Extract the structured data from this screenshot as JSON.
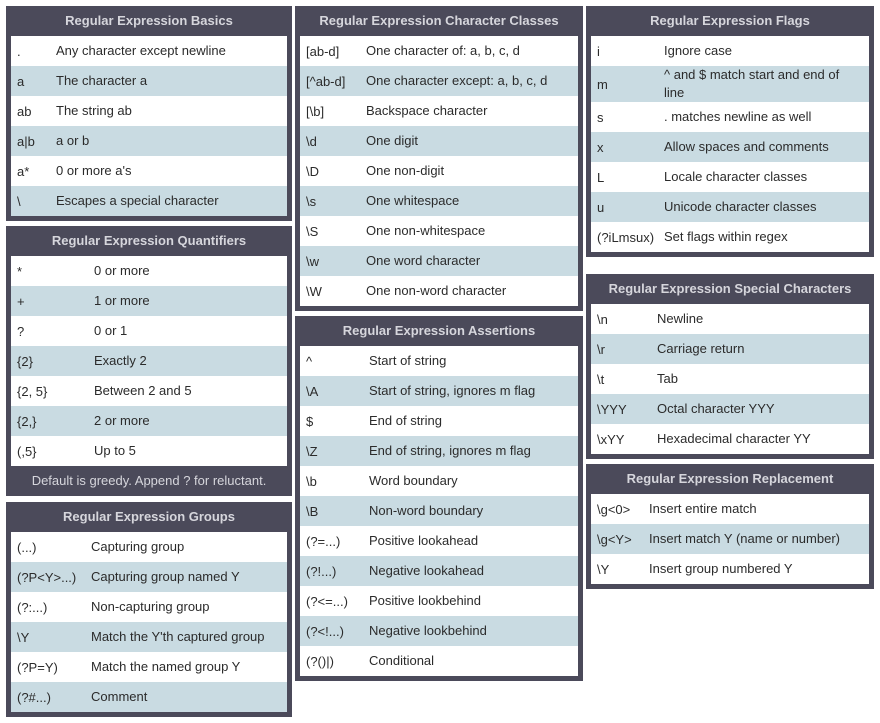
{
  "basics": {
    "title": "Regular Expression Basics",
    "rows": [
      {
        "k": ".",
        "v": "Any character except newline"
      },
      {
        "k": "a",
        "v": "The character a"
      },
      {
        "k": "ab",
        "v": "The string ab"
      },
      {
        "k": "a|b",
        "v": "a or b"
      },
      {
        "k": "a*",
        "v": "0 or more a's"
      },
      {
        "k": "\\",
        "v": "Escapes a special character"
      }
    ]
  },
  "quantifiers": {
    "title": "Regular Expression Quantifiers",
    "rows": [
      {
        "k": "*",
        "v": "0 or more"
      },
      {
        "k": "+",
        "v": "1 or more"
      },
      {
        "k": "?",
        "v": "0 or 1"
      },
      {
        "k": "{2}",
        "v": "Exactly 2"
      },
      {
        "k": "{2, 5}",
        "v": "Between 2 and 5"
      },
      {
        "k": "{2,}",
        "v": "2 or more"
      },
      {
        "k": "(,5}",
        "v": "Up to 5"
      }
    ],
    "footer": "Default is greedy. Append ? for reluctant."
  },
  "groups": {
    "title": "Regular Expression Groups",
    "rows": [
      {
        "k": "(...)",
        "v": "Capturing group"
      },
      {
        "k": "(?P<Y>...)",
        "v": "Capturing group named Y"
      },
      {
        "k": "(?:...)",
        "v": "Non-capturing group"
      },
      {
        "k": "\\Y",
        "v": "Match the Y'th captured group"
      },
      {
        "k": "(?P=Y)",
        "v": "Match the named group Y"
      },
      {
        "k": "(?#...)",
        "v": "Comment"
      }
    ]
  },
  "character_classes": {
    "title": "Regular Expression Character Classes",
    "rows": [
      {
        "k": "[ab-d]",
        "v": "One character of: a, b, c, d"
      },
      {
        "k": "[^ab-d]",
        "v": "One character except: a, b, c, d"
      },
      {
        "k": "[\\b]",
        "v": "Backspace character"
      },
      {
        "k": "\\d",
        "v": "One digit"
      },
      {
        "k": "\\D",
        "v": "One non-digit"
      },
      {
        "k": "\\s",
        "v": "One whitespace"
      },
      {
        "k": "\\S",
        "v": "One non-whitespace"
      },
      {
        "k": "\\w",
        "v": "One word character"
      },
      {
        "k": "\\W",
        "v": "One non-word character"
      }
    ]
  },
  "assertions": {
    "title": "Regular Expression Assertions",
    "rows": [
      {
        "k": "^",
        "v": "Start of string"
      },
      {
        "k": "\\A",
        "v": "Start of string, ignores m flag"
      },
      {
        "k": "$",
        "v": "End of string"
      },
      {
        "k": "\\Z",
        "v": "End of string, ignores m flag"
      },
      {
        "k": "\\b",
        "v": "Word boundary"
      },
      {
        "k": "\\B",
        "v": "Non-word boundary"
      },
      {
        "k": "(?=...)",
        "v": "Positive lookahead"
      },
      {
        "k": "(?!...)",
        "v": "Negative lookahead"
      },
      {
        "k": "(?<=...)",
        "v": "Positive lookbehind"
      },
      {
        "k": "(?<!...)",
        "v": "Negative lookbehind"
      },
      {
        "k": "(?()|)",
        "v": "Conditional"
      }
    ]
  },
  "flags": {
    "title": "Regular Expression Flags",
    "rows": [
      {
        "k": "i",
        "v": "Ignore case"
      },
      {
        "k": "m",
        "v": "^ and $ match start and end of line"
      },
      {
        "k": "s",
        "v": ". matches newline as well"
      },
      {
        "k": "x",
        "v": "Allow spaces and comments"
      },
      {
        "k": "L",
        "v": "Locale character classes"
      },
      {
        "k": "u",
        "v": "Unicode character classes"
      },
      {
        "k": "(?iLmsux)",
        "v": "Set flags within regex"
      }
    ]
  },
  "special_characters": {
    "title": "Regular Expression Special Characters",
    "rows": [
      {
        "k": "\\n",
        "v": "Newline"
      },
      {
        "k": "\\r",
        "v": "Carriage return"
      },
      {
        "k": "\\t",
        "v": "Tab"
      },
      {
        "k": "\\YYY",
        "v": "Octal character YYY"
      },
      {
        "k": "\\xYY",
        "v": "Hexadecimal character YY"
      }
    ]
  },
  "replacement": {
    "title": "Regular Expression Replacement",
    "rows": [
      {
        "k": "\\g<0>",
        "v": "Insert entire match"
      },
      {
        "k": "\\g<Y>",
        "v": "Insert match Y (name or number)"
      },
      {
        "k": "\\Y",
        "v": "Insert group numbered Y"
      }
    ]
  }
}
